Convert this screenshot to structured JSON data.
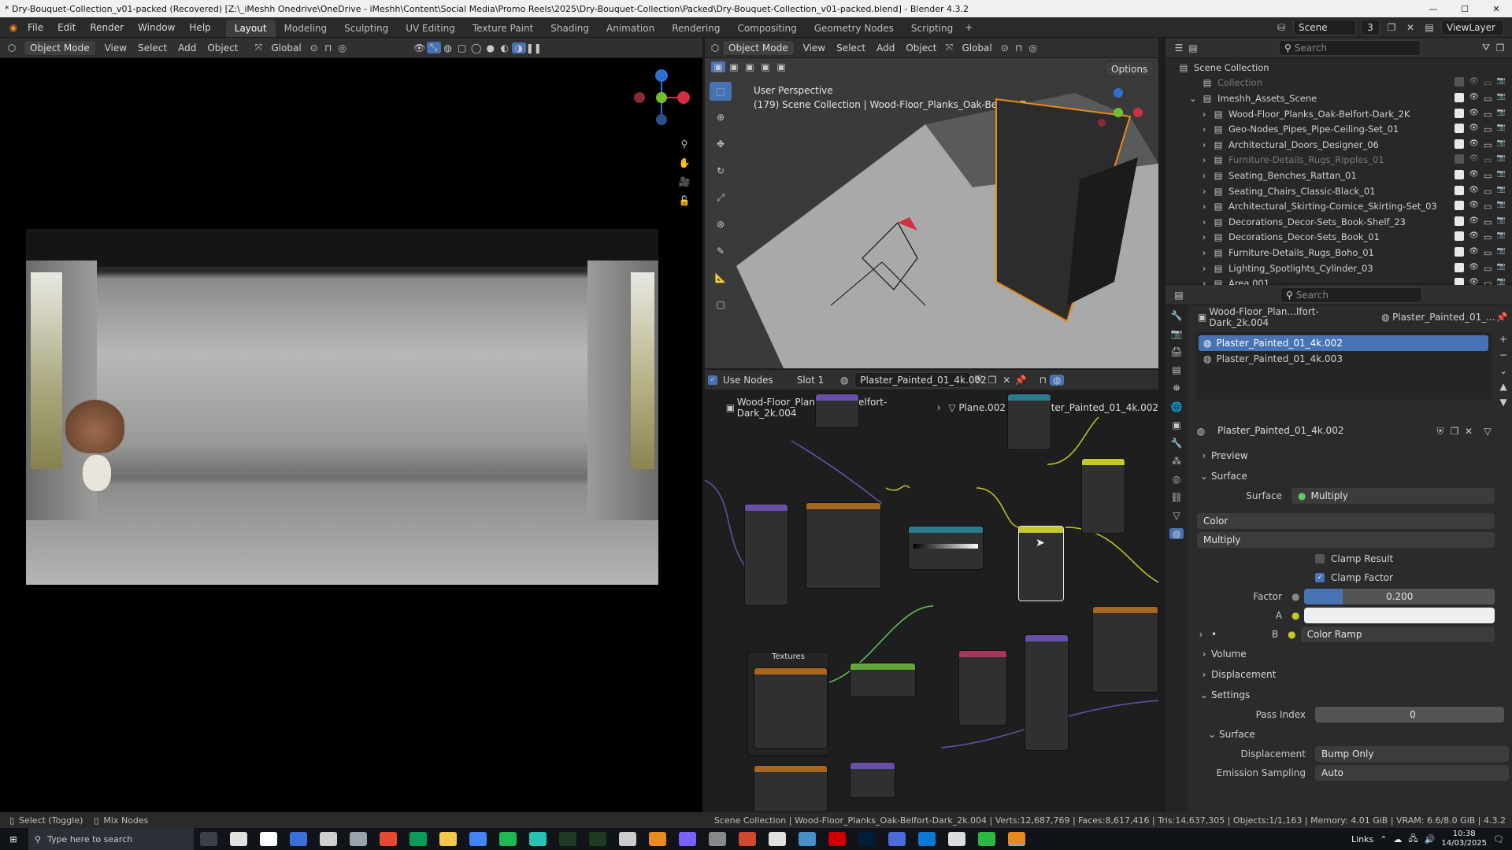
{
  "window": {
    "title": "* Dry-Bouquet-Collection_v01-packed (Recovered) [Z:\\_iMeshh Onedrive\\OneDrive - iMeshh\\Content\\Social Media\\Promo Reels\\2025\\Dry-Bouquet-Collection\\Packed\\Dry-Bouquet-Collection_v01-packed.blend] - Blender 4.3.2",
    "controls": [
      "—",
      "☐",
      "✕"
    ]
  },
  "menubar": {
    "menus": [
      "File",
      "Edit",
      "Render",
      "Window",
      "Help"
    ],
    "workspaces": [
      "Layout",
      "Modeling",
      "Sculpting",
      "UV Editing",
      "Texture Paint",
      "Shading",
      "Animation",
      "Rendering",
      "Compositing",
      "Geometry Nodes",
      "Scripting"
    ],
    "active_workspace": "Layout",
    "scene": "Scene",
    "scene_users": "3",
    "view_layer": "ViewLayer"
  },
  "left_viewport": {
    "mode": "Object Mode",
    "menus": [
      "View",
      "Select",
      "Add",
      "Object"
    ],
    "orientation": "Global"
  },
  "top_viewport": {
    "mode": "Object Mode",
    "menus": [
      "View",
      "Select",
      "Add",
      "Object"
    ],
    "orientation": "Global",
    "options": "Options",
    "overlay_line1": "User Perspective",
    "overlay_line2": "(179) Scene Collection | Wood-Floor_Planks_Oak-Belfort-Dark_2k.004"
  },
  "node_editor": {
    "use_nodes": "Use Nodes",
    "slot": "Slot 1",
    "material": "Plaster_Painted_01_4k.002",
    "breadcrumb": [
      "Wood-Floor_Planks_Oak-Belfort-Dark_2k.004",
      "Plane.002",
      "Plaster_Painted_01_4k.002"
    ],
    "frame_label": "Textures"
  },
  "outliner": {
    "search_placeholder": "Search",
    "root": "Scene Collection",
    "items": [
      {
        "name": "Collection",
        "level": 1,
        "dim": true
      },
      {
        "name": "Imeshh_Assets_Scene",
        "level": 1,
        "dim": false
      },
      {
        "name": "Wood-Floor_Planks_Oak-Belfort-Dark_2K",
        "level": 2,
        "dim": false
      },
      {
        "name": "Geo-Nodes_Pipes_Pipe-Ceiling-Set_01",
        "level": 2,
        "dim": false
      },
      {
        "name": "Architectural_Doors_Designer_06",
        "level": 2,
        "dim": false
      },
      {
        "name": "Furniture-Details_Rugs_Ripples_01",
        "level": 2,
        "dim": true
      },
      {
        "name": "Seating_Benches_Rattan_01",
        "level": 2,
        "dim": false
      },
      {
        "name": "Seating_Chairs_Classic-Black_01",
        "level": 2,
        "dim": false
      },
      {
        "name": "Architectural_Skirting-Cornice_Skirting-Set_03",
        "level": 2,
        "dim": false
      },
      {
        "name": "Decorations_Decor-Sets_Book-Shelf_23",
        "level": 2,
        "dim": false
      },
      {
        "name": "Decorations_Decor-Sets_Book_01",
        "level": 2,
        "dim": false
      },
      {
        "name": "Furniture-Details_Rugs_Boho_01",
        "level": 2,
        "dim": false
      },
      {
        "name": "Lighting_Spotlights_Cylinder_03",
        "level": 2,
        "dim": false
      },
      {
        "name": "Area.001",
        "level": 2,
        "dim": false
      }
    ]
  },
  "properties": {
    "search_placeholder": "Search",
    "breadcrumb_object": "Wood-Floor_Plan...lfort-Dark_2k.004",
    "breadcrumb_material": "Plaster_Painted_01_...",
    "slots": [
      "Plaster_Painted_01_4k.002",
      "Plaster_Painted_01_4k.003"
    ],
    "material_name": "Plaster_Painted_01_4k.002",
    "panels": {
      "preview": "Preview",
      "surface": "Surface",
      "volume": "Volume",
      "displacement": "Displacement",
      "settings": "Settings",
      "settings_surface": "Surface"
    },
    "surface_label": "Surface",
    "surface_value": "Multiply",
    "color_dropdown": "Color",
    "blend_dropdown": "Multiply",
    "clamp_result": "Clamp Result",
    "clamp_factor": "Clamp Factor",
    "factor_label": "Factor",
    "factor_value": "0.200",
    "factor_fraction": 0.2,
    "a_label": "A",
    "b_label": "B",
    "b_value": "Color Ramp",
    "pass_index_label": "Pass Index",
    "pass_index_value": "0",
    "displacement_label": "Displacement",
    "displacement_value": "Bump Only",
    "emission_label": "Emission Sampling",
    "emission_value": "Auto"
  },
  "statusbar": {
    "left1": "Select (Toggle)",
    "left2": "Mix Nodes",
    "info": "Scene Collection | Wood-Floor_Planks_Oak-Belfort-Dark_2k.004 | Verts:12,687,769 | Faces:8,617,416 | Tris:14,637,305 | Objects:1/1,163 | Memory: 4.01 GiB | VRAM: 6.6/8.0 GiB | 4.3.2"
  },
  "taskbar": {
    "search_placeholder": "Type here to search",
    "tray_links": "Links",
    "time": "10:38",
    "date": "14/03/2025"
  },
  "colors": {
    "accent_blue": "#4772b3",
    "selected_row": "#334d80",
    "socket_yellow": "#c7c729",
    "socket_green": "#63c763",
    "node_orange": "#a8671f",
    "node_purple": "#6a4fa8",
    "node_teal": "#2b7b8c",
    "node_pink": "#a8365c"
  }
}
